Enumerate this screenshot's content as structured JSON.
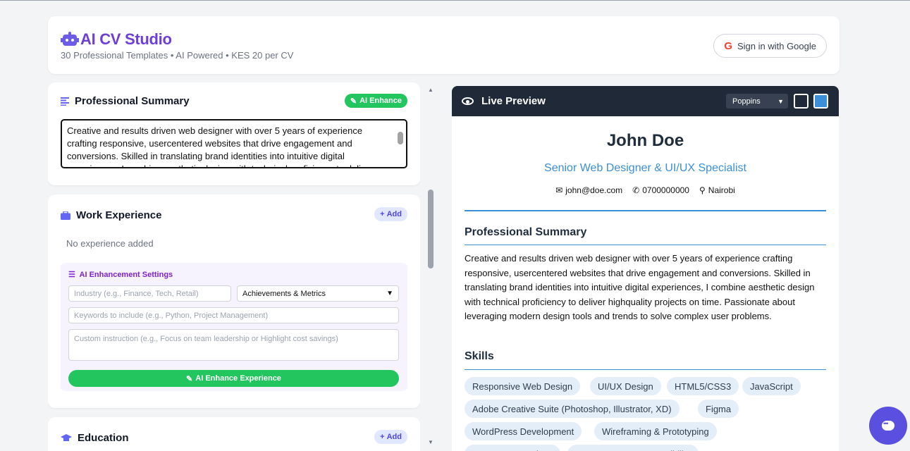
{
  "header": {
    "title": "AI CV Studio",
    "subtitle": "30 Professional Templates • AI Powered • KES 20 per CV",
    "signin_label": "Sign in with Google"
  },
  "summary_card": {
    "title": "Professional Summary",
    "ai_enhance_label": "AI Enhance",
    "text": "Creative and results driven web designer with over 5 years of experience crafting responsive, usercentered websites that drive engagement and conversions. Skilled in translating brand identities into intuitive digital experiences, I combine aesthetic design with technical proficiency to deliver"
  },
  "experience_card": {
    "title": "Work Experience",
    "add_label": "Add",
    "empty_text": "No experience added",
    "ai_settings": {
      "title": "AI Enhancement Settings",
      "industry_placeholder": "Industry (e.g., Finance, Tech, Retail)",
      "focus_value": "Achievements & Metrics",
      "keywords_placeholder": "Keywords to include (e.g., Python, Project Management)",
      "custom_placeholder": "Custom instruction (e.g., Focus on team leadership or Highlight cost savings)",
      "button_label": "AI Enhance Experience"
    }
  },
  "education_card": {
    "title": "Education",
    "add_label": "Add"
  },
  "preview": {
    "title": "Live Preview",
    "font_value": "Poppins",
    "colors": {
      "dark": "#1f2937",
      "accent": "#3b8fd6"
    },
    "name": "John Doe",
    "role": "Senior Web Designer & UI/UX Specialist",
    "email": "john@doe.com",
    "phone": "0700000000",
    "location": "Nairobi",
    "summary_heading": "Professional Summary",
    "summary": "Creative and results driven web designer with over 5 years of experience crafting responsive, usercentered websites that drive engagement and conversions. Skilled in translating brand identities into intuitive digital experiences, I combine aesthetic design with technical proficiency to deliver highquality projects on time. Passionate about leveraging modern design tools and trends to solve complex user problems.",
    "skills_heading": "Skills",
    "skills": [
      "Responsive Web Design",
      "UI/UX Design",
      "HTML5/CSS3",
      "JavaScript",
      "Adobe Creative Suite (Photoshop, Illustrator, XD)",
      "Figma",
      "WordPress Development",
      "Wireframing & Prototyping",
      "SEO Best Practices",
      "Cross-Browser Compatibility"
    ]
  }
}
